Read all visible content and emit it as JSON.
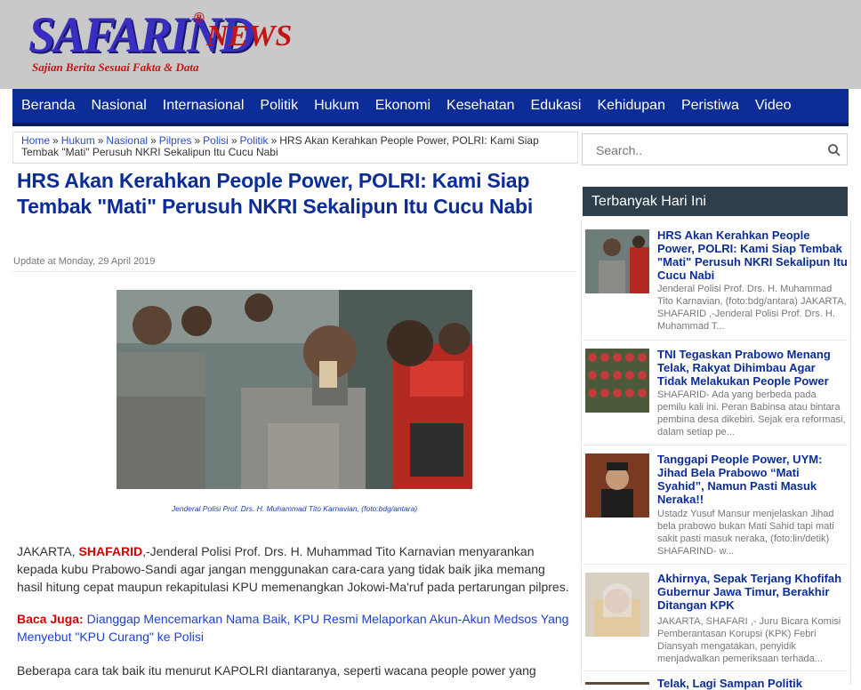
{
  "brand": {
    "name": "SAFARIND",
    "reg": "®",
    "news": "NEWS",
    "tagline": "Sajian Berita Sesuai Fakta & Data"
  },
  "nav": [
    "Beranda",
    "Nasional",
    "Internasional",
    "Politik",
    "Hukum",
    "Ekonomi",
    "Kesehatan",
    "Edukasi",
    "Kehidupan",
    "Peristiwa",
    "Video"
  ],
  "breadcrumb": {
    "links": [
      "Home",
      "Hukum",
      "Nasional",
      "Pilpres",
      "Polisi",
      "Politik"
    ],
    "sep": "»",
    "current": "HRS Akan Kerahkan People Power, POLRI: Kami Siap Tembak \"Mati\" Perusuh NKRI Sekalipun Itu Cucu Nabi"
  },
  "article": {
    "title": "HRS Akan Kerahkan People Power, POLRI: Kami Siap Tembak \"Mati\" Perusuh NKRI Sekalipun Itu Cucu Nabi",
    "date_label": "Update at",
    "date": "Monday, 29 April 2019",
    "caption": "Jenderal Polisi Prof. Drs. H. Muhammad Tito Karnavian, (foto:bdg/antara)",
    "p1_city": "JAKARTA,",
    "p1_source": "SHAFARID",
    "p1_text": ",-Jenderal Polisi Prof. Drs. H. Muhammad Tito Karnavian menyarankan kepada kubu Prabowo-Sandi agar jangan menggunakan cara-cara yang tidak baik jika memang hasil hitung cepat maupun rekapitulasi KPU memenangkan Jokowi-Ma'ruf pada pertarungan pilpres.",
    "baca_label": "Baca Juga:",
    "baca_link": "Dianggap Mencemarkan Nama Baik, KPU Resmi Melaporkan Akun-Akun Medsos Yang Menyebut \"KPU Curang\" ke Polisi",
    "p3_text": "Beberapa cara tak baik itu menurut KAPOLRI diantaranya, seperti wacana people power yang"
  },
  "search": {
    "placeholder": "Search.."
  },
  "sidebar": {
    "heading": "Terbanyak Hari Ini",
    "items": [
      {
        "title": "HRS Akan Kerahkan People Power, POLRI: Kami Siap Tembak \"Mati\" Perusuh NKRI Sekalipun Itu Cucu Nabi",
        "snippet": "Jenderal Polisi Prof. Drs. H. Muhammad Tito Karnavian, (foto:bdg/antara) JAKARTA,  SHAFARID ,-Jenderal Polisi Prof. Drs. H. Muhammad T..."
      },
      {
        "title": "TNI Tegaskan Prabowo Menang Telak, Rakyat Dihimbau Agar Tidak Melakukan People Power",
        "snippet": "SHAFARID- Ada yang berbeda pada pemilu kali ini. Peran Babinsa atau bintara pembina desa dikebiri. Sejak era reformasi, dalam setiap pe..."
      },
      {
        "title": "Tanggapi People Power, UYM: Jihad Bela Prabowo “Mati Syahid”, Namun Pasti Masuk Neraka!!",
        "snippet": "Ustadz Yusuf Mansur menjelaskan Jihad bela prabowo bukan Mati Sahid tapi mati sakit pasti masuk neraka, (foto:lin/detik) SHAFARIND- w..."
      },
      {
        "title": "Akhirnya, Sepak Terjang Khofifah Gubernur Jawa Timur, Berakhir Ditangan KPK",
        "snippet": "JAKARTA, SHAFARI ,- Juru Bicara Komisi Pemberantasan Korupsi (KPK) Febri Diansyah mengatakan, penyidik menjadwalkan pemeriksaan terhada..."
      },
      {
        "title": "Telak, Lagi Sampan Politik",
        "snippet": ""
      }
    ]
  },
  "colors": {
    "nav_bg": "#0c2d97",
    "title": "#0c2d97",
    "header_bg": "#c9c9c9",
    "side_head_bg": "#2e3f4b",
    "accent_red": "#d60000"
  }
}
